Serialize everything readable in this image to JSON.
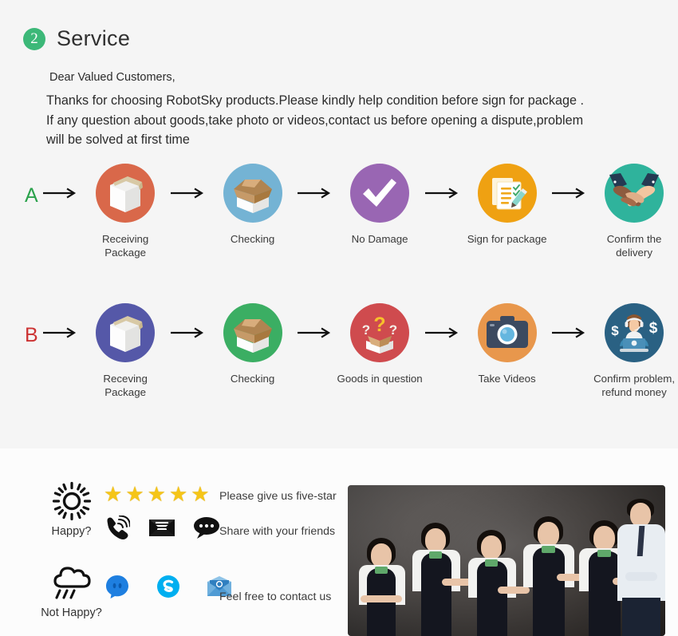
{
  "service": {
    "badge_number": "2",
    "title": "Service",
    "salutation": "Dear Valued Customers,",
    "paragraph_lines": [
      "Thanks for choosing RobotSky products.Please kindly help condition before sign for package .",
      "If any question about goods,take photo or videos,contact us before opening a dispute,problem",
      "will be solved at first time"
    ],
    "accent_green": "#3cb878"
  },
  "flow": {
    "rows": [
      {
        "letter": "A",
        "letter_color": "#2ba24c",
        "steps": [
          {
            "label": "Receiving Package",
            "icon": "closed-package-icon",
            "color": "#d9684a"
          },
          {
            "label": "Checking",
            "icon": "open-box-icon",
            "color": "#74b3d4"
          },
          {
            "label": "No Damage",
            "icon": "checkmark-icon",
            "color": "#9966b3"
          },
          {
            "label": "Sign for package",
            "icon": "clipboard-pen-icon",
            "color": "#efa112"
          },
          {
            "label": "Confirm the delivery",
            "icon": "handshake-icon",
            "color": "#2fb39c"
          }
        ]
      },
      {
        "letter": "B",
        "letter_color": "#cc3333",
        "steps": [
          {
            "label": "Receving Package",
            "icon": "closed-package-icon",
            "color": "#5558a8"
          },
          {
            "label": "Checking",
            "icon": "open-box-icon",
            "color": "#3bae63"
          },
          {
            "label": "Goods in question",
            "icon": "question-box-icon",
            "color": "#cf4b4e"
          },
          {
            "label": "Take Videos",
            "icon": "camera-icon",
            "color": "#e8974c"
          },
          {
            "label": "Confirm problem,\nrefund money",
            "icon": "support-agent-icon",
            "color": "#2a6183"
          }
        ]
      }
    ],
    "arrow_icon": "right-arrow-icon"
  },
  "contact": {
    "moods": [
      {
        "label": "Happy?",
        "icon": "sun-icon"
      },
      {
        "label": "Not Happy?",
        "icon": "rain-cloud-icon"
      }
    ],
    "star_count": 5,
    "star_glyph": "★",
    "star_color": "#f5c518",
    "happy_icons": [
      "phone-ring-icon",
      "mail-envelope-icon",
      "chat-bubble-icon"
    ],
    "nothappy_icons": [
      "messenger-icon",
      "skype-icon",
      "email-open-icon"
    ],
    "messages": [
      "Please give us five-star",
      "Share with your friends",
      "Feel free to contact us"
    ]
  },
  "photo": {
    "alt_name": "customer-service-team-photo"
  }
}
